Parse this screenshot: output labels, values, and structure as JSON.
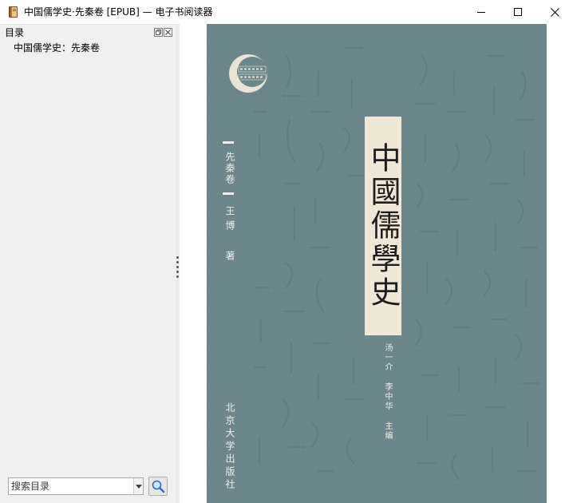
{
  "window": {
    "title": "中国儒学史·先秦卷 [EPUB] — 电子书阅读器"
  },
  "toc_panel": {
    "title": "目录",
    "items": [
      {
        "label": "中国儒学史：先秦卷"
      }
    ],
    "search": {
      "placeholder": "搜索目录",
      "value": ""
    }
  },
  "cover": {
    "main_title": "中國儒學史",
    "volume": "先秦卷",
    "author": "王博 著",
    "editors": "汤一介 李中华 主编",
    "publisher": "北京大学出版社",
    "logo_text": "国家社科基金 后期资助项目"
  },
  "colors": {
    "cover_bg": "#6b878c",
    "title_band": "#f1e7d6",
    "sidebar_bg": "#f0f0f0"
  },
  "icons": {
    "app": "book-icon",
    "minimize": "minimize-icon",
    "maximize": "maximize-icon",
    "close": "close-icon",
    "search": "magnifier-icon"
  }
}
